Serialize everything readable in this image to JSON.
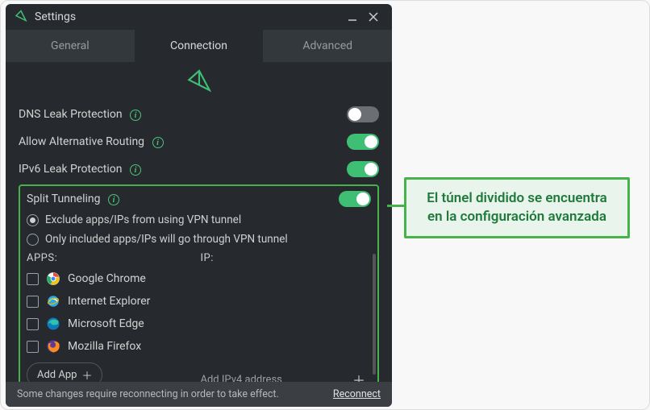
{
  "window": {
    "title": "Settings"
  },
  "tabs": {
    "general": "General",
    "connection": "Connection",
    "advanced": "Advanced"
  },
  "settings": {
    "dns": "DNS Leak Protection",
    "altRouting": "Allow Alternative Routing",
    "ipv6": "IPv6 Leak Protection",
    "splitTunnel": "Split Tunneling",
    "radioExclude": "Exclude apps/IPs from using VPN tunnel",
    "radioInclude": "Only included apps/IPs will go through VPN tunnel",
    "appsHeader": "APPS:",
    "ipHeader": "IP:",
    "apps": {
      "chrome": "Google Chrome",
      "ie": "Internet Explorer",
      "edge": "Microsoft Edge",
      "firefox": "Mozilla Firefox"
    },
    "addApp": "Add App",
    "addIpPlaceholder": "Add IPv4 address"
  },
  "footer": {
    "text": "Some changes require reconnecting in order to take effect.",
    "link": "Reconnect"
  },
  "callout": {
    "text": "El túnel dividido se encuentra en la configuración avanzada"
  }
}
